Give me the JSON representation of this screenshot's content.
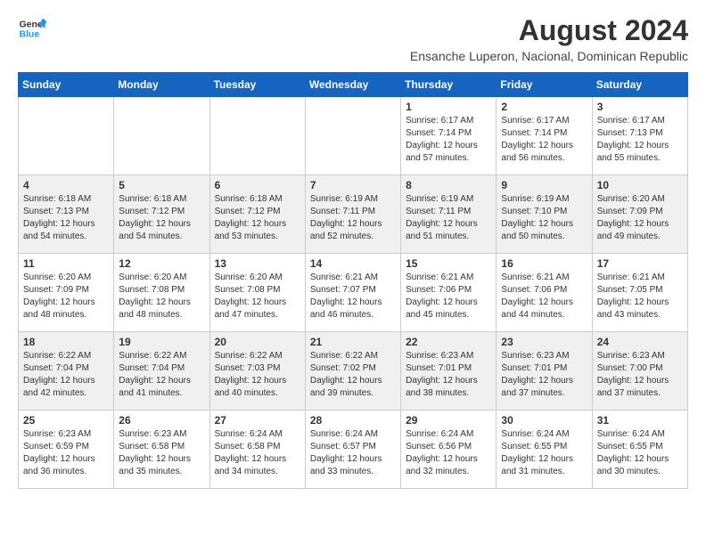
{
  "header": {
    "logo_line1": "General",
    "logo_line2": "Blue",
    "title": "August 2024",
    "subtitle": "Ensanche Luperon, Nacional, Dominican Republic"
  },
  "calendar": {
    "headers": [
      "Sunday",
      "Monday",
      "Tuesday",
      "Wednesday",
      "Thursday",
      "Friday",
      "Saturday"
    ],
    "rows": [
      [
        {
          "day": "",
          "info": ""
        },
        {
          "day": "",
          "info": ""
        },
        {
          "day": "",
          "info": ""
        },
        {
          "day": "",
          "info": ""
        },
        {
          "day": "1",
          "info": "Sunrise: 6:17 AM\nSunset: 7:14 PM\nDaylight: 12 hours\nand 57 minutes."
        },
        {
          "day": "2",
          "info": "Sunrise: 6:17 AM\nSunset: 7:14 PM\nDaylight: 12 hours\nand 56 minutes."
        },
        {
          "day": "3",
          "info": "Sunrise: 6:17 AM\nSunset: 7:13 PM\nDaylight: 12 hours\nand 55 minutes."
        }
      ],
      [
        {
          "day": "4",
          "info": "Sunrise: 6:18 AM\nSunset: 7:13 PM\nDaylight: 12 hours\nand 54 minutes."
        },
        {
          "day": "5",
          "info": "Sunrise: 6:18 AM\nSunset: 7:12 PM\nDaylight: 12 hours\nand 54 minutes."
        },
        {
          "day": "6",
          "info": "Sunrise: 6:18 AM\nSunset: 7:12 PM\nDaylight: 12 hours\nand 53 minutes."
        },
        {
          "day": "7",
          "info": "Sunrise: 6:19 AM\nSunset: 7:11 PM\nDaylight: 12 hours\nand 52 minutes."
        },
        {
          "day": "8",
          "info": "Sunrise: 6:19 AM\nSunset: 7:11 PM\nDaylight: 12 hours\nand 51 minutes."
        },
        {
          "day": "9",
          "info": "Sunrise: 6:19 AM\nSunset: 7:10 PM\nDaylight: 12 hours\nand 50 minutes."
        },
        {
          "day": "10",
          "info": "Sunrise: 6:20 AM\nSunset: 7:09 PM\nDaylight: 12 hours\nand 49 minutes."
        }
      ],
      [
        {
          "day": "11",
          "info": "Sunrise: 6:20 AM\nSunset: 7:09 PM\nDaylight: 12 hours\nand 48 minutes."
        },
        {
          "day": "12",
          "info": "Sunrise: 6:20 AM\nSunset: 7:08 PM\nDaylight: 12 hours\nand 48 minutes."
        },
        {
          "day": "13",
          "info": "Sunrise: 6:20 AM\nSunset: 7:08 PM\nDaylight: 12 hours\nand 47 minutes."
        },
        {
          "day": "14",
          "info": "Sunrise: 6:21 AM\nSunset: 7:07 PM\nDaylight: 12 hours\nand 46 minutes."
        },
        {
          "day": "15",
          "info": "Sunrise: 6:21 AM\nSunset: 7:06 PM\nDaylight: 12 hours\nand 45 minutes."
        },
        {
          "day": "16",
          "info": "Sunrise: 6:21 AM\nSunset: 7:06 PM\nDaylight: 12 hours\nand 44 minutes."
        },
        {
          "day": "17",
          "info": "Sunrise: 6:21 AM\nSunset: 7:05 PM\nDaylight: 12 hours\nand 43 minutes."
        }
      ],
      [
        {
          "day": "18",
          "info": "Sunrise: 6:22 AM\nSunset: 7:04 PM\nDaylight: 12 hours\nand 42 minutes."
        },
        {
          "day": "19",
          "info": "Sunrise: 6:22 AM\nSunset: 7:04 PM\nDaylight: 12 hours\nand 41 minutes."
        },
        {
          "day": "20",
          "info": "Sunrise: 6:22 AM\nSunset: 7:03 PM\nDaylight: 12 hours\nand 40 minutes."
        },
        {
          "day": "21",
          "info": "Sunrise: 6:22 AM\nSunset: 7:02 PM\nDaylight: 12 hours\nand 39 minutes."
        },
        {
          "day": "22",
          "info": "Sunrise: 6:23 AM\nSunset: 7:01 PM\nDaylight: 12 hours\nand 38 minutes."
        },
        {
          "day": "23",
          "info": "Sunrise: 6:23 AM\nSunset: 7:01 PM\nDaylight: 12 hours\nand 37 minutes."
        },
        {
          "day": "24",
          "info": "Sunrise: 6:23 AM\nSunset: 7:00 PM\nDaylight: 12 hours\nand 37 minutes."
        }
      ],
      [
        {
          "day": "25",
          "info": "Sunrise: 6:23 AM\nSunset: 6:59 PM\nDaylight: 12 hours\nand 36 minutes."
        },
        {
          "day": "26",
          "info": "Sunrise: 6:23 AM\nSunset: 6:58 PM\nDaylight: 12 hours\nand 35 minutes."
        },
        {
          "day": "27",
          "info": "Sunrise: 6:24 AM\nSunset: 6:58 PM\nDaylight: 12 hours\nand 34 minutes."
        },
        {
          "day": "28",
          "info": "Sunrise: 6:24 AM\nSunset: 6:57 PM\nDaylight: 12 hours\nand 33 minutes."
        },
        {
          "day": "29",
          "info": "Sunrise: 6:24 AM\nSunset: 6:56 PM\nDaylight: 12 hours\nand 32 minutes."
        },
        {
          "day": "30",
          "info": "Sunrise: 6:24 AM\nSunset: 6:55 PM\nDaylight: 12 hours\nand 31 minutes."
        },
        {
          "day": "31",
          "info": "Sunrise: 6:24 AM\nSunset: 6:55 PM\nDaylight: 12 hours\nand 30 minutes."
        }
      ]
    ]
  }
}
